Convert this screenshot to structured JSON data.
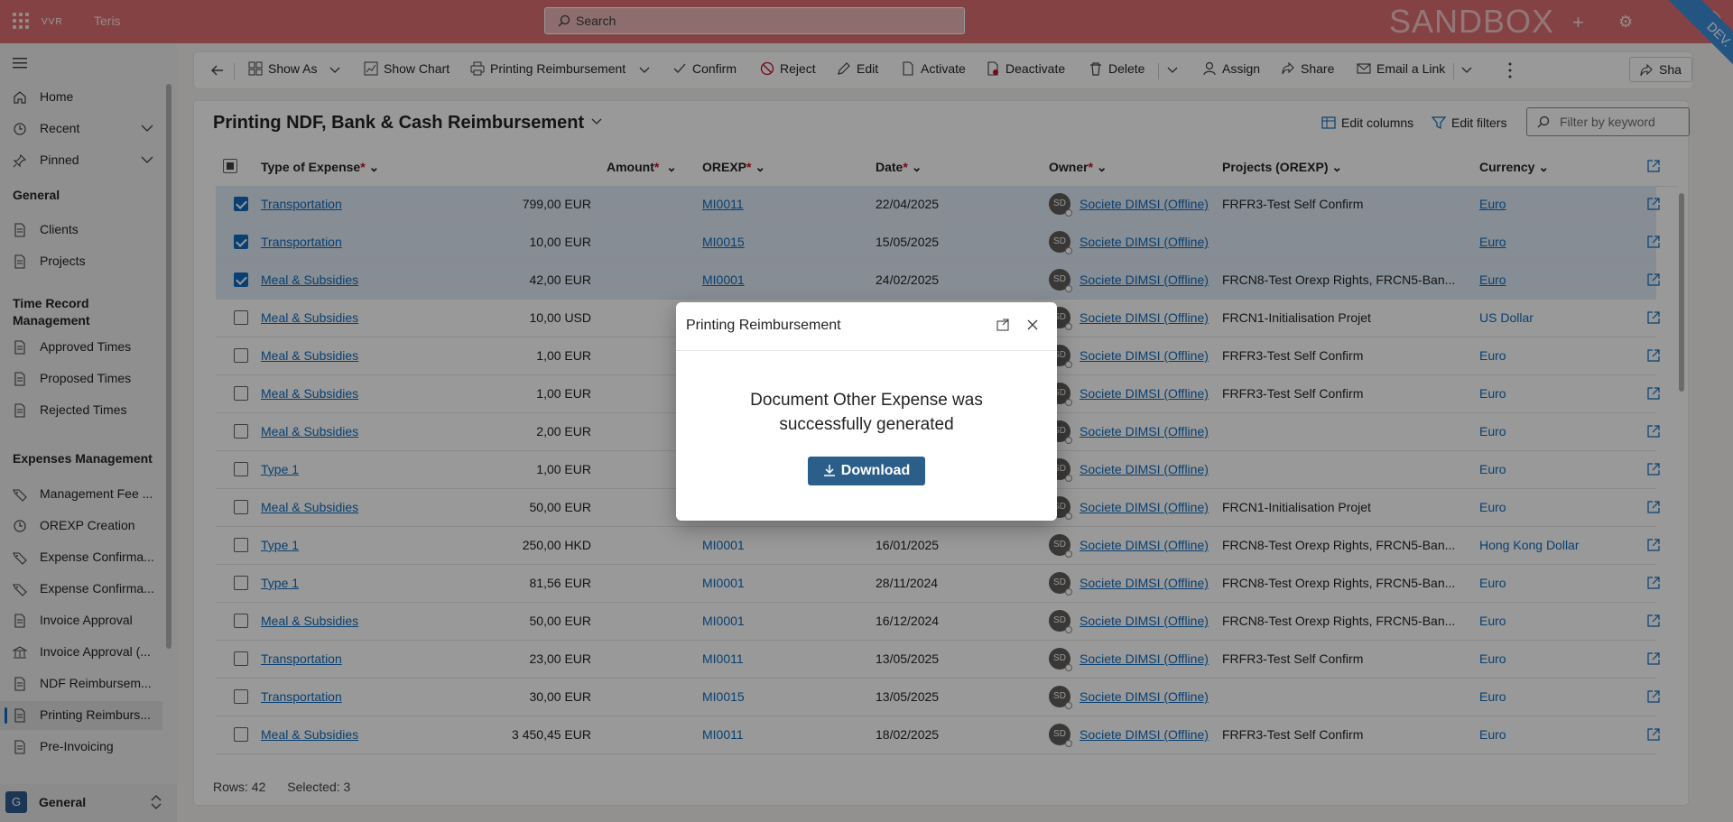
{
  "topbar": {
    "brand_logo": "VVR",
    "brand_name": "Teris",
    "search_placeholder": "Search",
    "env_label": "SANDBOX",
    "ribbon": "DEV.",
    "avatar": "SD"
  },
  "sidebar": {
    "items_top": [
      {
        "label": "Home",
        "icon": "home-icon"
      },
      {
        "label": "Recent",
        "icon": "clock-icon"
      },
      {
        "label": "Pinned",
        "icon": "pin-icon"
      }
    ],
    "groups": [
      {
        "title": "General",
        "items": [
          {
            "label": "Clients"
          },
          {
            "label": "Projects"
          }
        ]
      },
      {
        "title": "Time Record Management",
        "items": [
          {
            "label": "Approved Times"
          },
          {
            "label": "Proposed Times"
          },
          {
            "label": "Rejected Times"
          }
        ]
      },
      {
        "title": "Expenses Management",
        "items": [
          {
            "label": "Management Fee ..."
          },
          {
            "label": "OREXP Creation"
          },
          {
            "label": "Expense Confirma..."
          },
          {
            "label": "Expense Confirma..."
          },
          {
            "label": "Invoice Approval"
          },
          {
            "label": "Invoice Approval (..."
          },
          {
            "label": "NDF Reimbursem..."
          },
          {
            "label": "Printing Reimburs..."
          },
          {
            "label": "Pre-Invoicing"
          }
        ]
      }
    ],
    "area": {
      "badge": "G",
      "label": "General"
    }
  },
  "commands": {
    "show_as": "Show As",
    "show_chart": "Show Chart",
    "printing": "Printing Reimbursement",
    "confirm": "Confirm",
    "reject": "Reject",
    "edit": "Edit",
    "activate": "Activate",
    "deactivate": "Deactivate",
    "delete": "Delete",
    "assign": "Assign",
    "share": "Share",
    "email_link": "Email a Link",
    "share_right": "Sha"
  },
  "view": {
    "title": "Printing NDF, Bank & Cash Reimbursement",
    "edit_columns": "Edit columns",
    "edit_filters": "Edit filters",
    "filter_placeholder": "Filter by keyword"
  },
  "columns": {
    "type": "Type of Expense",
    "amount": "Amount",
    "orexp": "OREXP",
    "date": "Date",
    "owner": "Owner",
    "projects": "Projects (OREXP)",
    "currency": "Currency",
    "required_mark": "*"
  },
  "rows": [
    {
      "selected": true,
      "type": "Transportation",
      "amount": "799,00 EUR",
      "orexp": "MI0011",
      "date": "22/04/2025",
      "owner": "Societe DIMSI (Offline)",
      "projects": "FRFR3-Test Self Confirm",
      "currency": "Euro"
    },
    {
      "selected": true,
      "type": "Transportation",
      "amount": "10,00 EUR",
      "orexp": "MI0015",
      "date": "15/05/2025",
      "owner": "Societe DIMSI (Offline)",
      "projects": "",
      "currency": "Euro"
    },
    {
      "selected": true,
      "type": "Meal & Subsidies",
      "amount": "42,00 EUR",
      "orexp": "MI0001",
      "date": "24/02/2025",
      "owner": "Societe DIMSI (Offline)",
      "projects": "FRCN8-Test Orexp Rights, FRCN5-Ban...",
      "currency": "Euro"
    },
    {
      "selected": false,
      "type": "Meal & Subsidies",
      "amount": "10,00 USD",
      "orexp": "",
      "date": "",
      "owner": "Societe DIMSI (Offline)",
      "projects": "FRCN1-Initialisation Projet",
      "currency": "US Dollar"
    },
    {
      "selected": false,
      "type": "Meal & Subsidies",
      "amount": "1,00 EUR",
      "orexp": "",
      "date": "",
      "owner": "Societe DIMSI (Offline)",
      "projects": "FRFR3-Test Self Confirm",
      "currency": "Euro"
    },
    {
      "selected": false,
      "type": "Meal & Subsidies",
      "amount": "1,00 EUR",
      "orexp": "",
      "date": "",
      "owner": "Societe DIMSI (Offline)",
      "projects": "FRFR3-Test Self Confirm",
      "currency": "Euro"
    },
    {
      "selected": false,
      "type": "Meal & Subsidies",
      "amount": "2,00 EUR",
      "orexp": "",
      "date": "",
      "owner": "Societe DIMSI (Offline)",
      "projects": "",
      "currency": "Euro"
    },
    {
      "selected": false,
      "type": "Type 1",
      "amount": "1,00 EUR",
      "orexp": "",
      "date": "",
      "owner": "Societe DIMSI (Offline)",
      "projects": "",
      "currency": "Euro"
    },
    {
      "selected": false,
      "type": "Meal & Subsidies",
      "amount": "50,00 EUR",
      "orexp": "",
      "date": "",
      "owner": "Societe DIMSI (Offline)",
      "projects": "FRCN1-Initialisation Projet",
      "currency": "Euro"
    },
    {
      "selected": false,
      "type": "Type 1",
      "amount": "250,00 HKD",
      "orexp": "MI0001",
      "date": "16/01/2025",
      "owner": "Societe DIMSI (Offline)",
      "projects": "FRCN8-Test Orexp Rights, FRCN5-Ban...",
      "currency": "Hong Kong Dollar"
    },
    {
      "selected": false,
      "type": "Type 1",
      "amount": "81,56 EUR",
      "orexp": "MI0001",
      "date": "28/11/2024",
      "owner": "Societe DIMSI (Offline)",
      "projects": "FRCN8-Test Orexp Rights, FRCN5-Ban...",
      "currency": "Euro"
    },
    {
      "selected": false,
      "type": "Meal & Subsidies",
      "amount": "50,00 EUR",
      "orexp": "MI0001",
      "date": "16/12/2024",
      "owner": "Societe DIMSI (Offline)",
      "projects": "FRCN8-Test Orexp Rights, FRCN5-Ban...",
      "currency": "Euro"
    },
    {
      "selected": false,
      "type": "Transportation",
      "amount": "23,00 EUR",
      "orexp": "MI0011",
      "date": "13/05/2025",
      "owner": "Societe DIMSI (Offline)",
      "projects": "FRFR3-Test Self Confirm",
      "currency": "Euro"
    },
    {
      "selected": false,
      "type": "Transportation",
      "amount": "30,00 EUR",
      "orexp": "MI0015",
      "date": "13/05/2025",
      "owner": "Societe DIMSI (Offline)",
      "projects": "",
      "currency": "Euro"
    },
    {
      "selected": false,
      "type": "Meal & Subsidies",
      "amount": "3 450,45 EUR",
      "orexp": "MI0011",
      "date": "18/02/2025",
      "owner": "Societe DIMSI (Offline)",
      "projects": "FRFR3-Test Self Confirm",
      "currency": "Euro"
    }
  ],
  "owner_initials": "SD",
  "footer": {
    "rows": "Rows: 42",
    "selected": "Selected: 3"
  },
  "dialog": {
    "title": "Printing Reimbursement",
    "message": "Document Other Expense was successfully generated",
    "download": "Download"
  },
  "colors": {
    "topbar": "#dc6e72",
    "accent": "#0f6cbd",
    "download_button": "#2b5f8a"
  }
}
